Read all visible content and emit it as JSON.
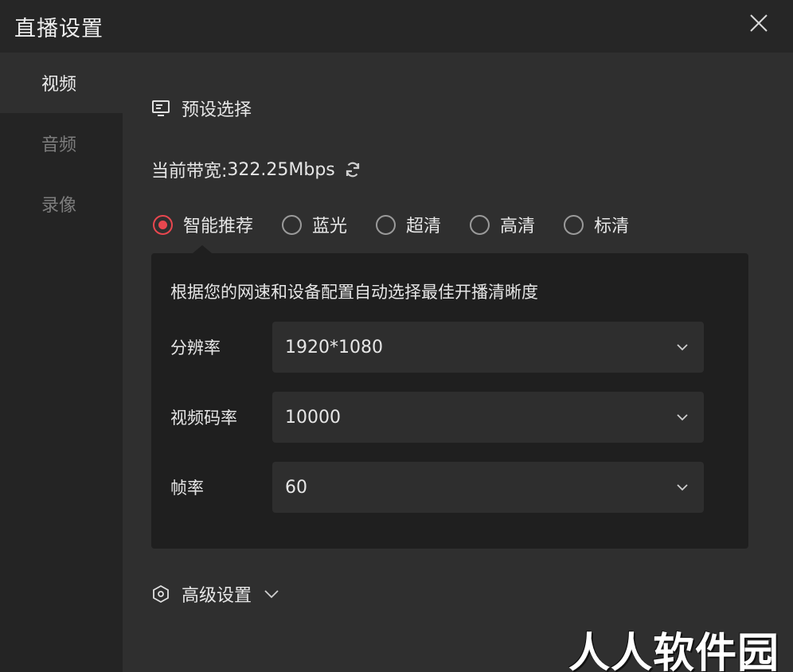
{
  "window": {
    "title": "直播设置"
  },
  "sidebar": {
    "items": [
      {
        "label": "视频",
        "active": true
      },
      {
        "label": "音频",
        "active": false
      },
      {
        "label": "录像",
        "active": false
      }
    ]
  },
  "preset": {
    "section_title": "预设选择",
    "icon": "monitor-icon"
  },
  "bandwidth": {
    "label": "当前带宽:",
    "value": "322.25Mbps",
    "icon": "refresh-icon"
  },
  "quality_options": [
    {
      "label": "智能推荐",
      "selected": true
    },
    {
      "label": "蓝光",
      "selected": false
    },
    {
      "label": "超清",
      "selected": false
    },
    {
      "label": "高清",
      "selected": false
    },
    {
      "label": "标清",
      "selected": false
    }
  ],
  "panel": {
    "description": "根据您的网速和设备配置自动选择最佳开播清晰度",
    "rows": [
      {
        "label": "分辨率",
        "value": "1920*1080"
      },
      {
        "label": "视频码率",
        "value": "10000"
      },
      {
        "label": "帧率",
        "value": "60"
      }
    ]
  },
  "advanced": {
    "label": "高级设置",
    "icon": "hexagon-settings-icon"
  },
  "watermark": {
    "text": "人人软件园"
  },
  "colors": {
    "accent": "#e8474f",
    "background": "#2f2f2f",
    "panel": "#1f1f1f",
    "sidebar": "#242424"
  }
}
